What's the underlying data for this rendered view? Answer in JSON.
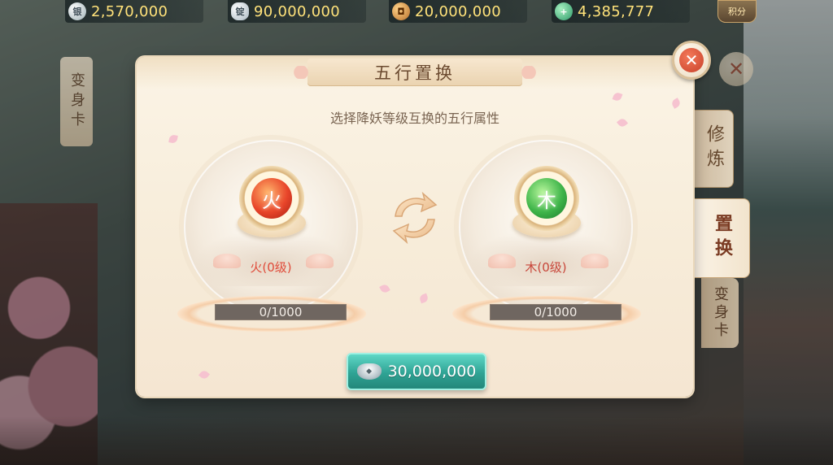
{
  "resources": {
    "silver_coin": {
      "icon": "silver-coin-icon",
      "value": "2,570,000"
    },
    "silver_ingot": {
      "icon": "silver-ingot-icon",
      "value": "90,000,000"
    },
    "copper_coin": {
      "icon": "copper-coin-icon",
      "value": "20,000,000"
    },
    "jade": {
      "icon": "jade-icon",
      "value": "4,385,777"
    },
    "score_badge": {
      "icon": "score-badge-icon",
      "label": "积分"
    }
  },
  "background": {
    "left_card_label": "变身卡"
  },
  "tabs": [
    {
      "id": "xiulian",
      "label": "修炼",
      "active": false
    },
    {
      "id": "zhihuan",
      "label": "置换",
      "active": true
    },
    {
      "id": "bianshen",
      "label": "变身卡",
      "active": false
    }
  ],
  "dialog": {
    "title": "五行置换",
    "subtitle": "选择降妖等级互换的五行属性",
    "left": {
      "element_glyph": "火",
      "label": "火(0级)",
      "progress_text": "0/1000",
      "progress_fraction": 0,
      "color": "#e8452a"
    },
    "right": {
      "element_glyph": "木",
      "label": "木(0级)",
      "progress_text": "0/1000",
      "progress_fraction": 0,
      "color": "#3fb54a"
    },
    "swap_icon": "swap-arrows-icon",
    "cost": {
      "icon": "silver-ingot-icon",
      "amount": "30,000,000"
    },
    "close_icon": "close-icon"
  },
  "colors": {
    "accent_teal": "#2fa394",
    "currency_text": "#ffe27a",
    "title_text": "#6b4a30"
  }
}
